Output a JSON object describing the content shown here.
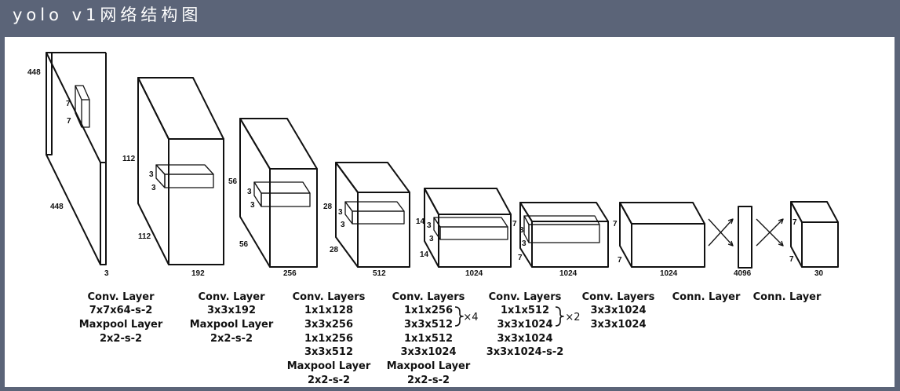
{
  "header": {
    "title": "yolo v1网络结构图"
  },
  "diagram": {
    "dims": {
      "in_448_top": "448",
      "in_448_side": "448",
      "in_3": "3",
      "in_k7a": "7",
      "in_k7b": "7",
      "b1_112a": "112",
      "b1_112b": "112",
      "b1_192": "192",
      "b1_k3a": "3",
      "b1_k3b": "3",
      "b2_56a": "56",
      "b2_56b": "56",
      "b2_256": "256",
      "b2_k3a": "3",
      "b2_k3b": "3",
      "b3_28a": "28",
      "b3_28b": "28",
      "b3_512": "512",
      "b3_k3a": "3",
      "b3_k3b": "3",
      "b4_14a": "14",
      "b4_14b": "14",
      "b4_1024": "1024",
      "b4_k3a": "3",
      "b4_k3b": "3",
      "b5_7a": "7",
      "b5_7b": "7",
      "b5_1024": "1024",
      "b5_k3a": "3",
      "b5_k3b": "3",
      "b6_7a": "7",
      "b6_7b": "7",
      "b6_1024": "1024",
      "fc_4096": "4096",
      "out_7a": "7",
      "out_7b": "7",
      "out_30": "30"
    },
    "captions": {
      "c1": [
        "Conv. Layer",
        "7x7x64-s-2",
        "Maxpool Layer",
        "2x2-s-2"
      ],
      "c2": [
        "Conv. Layer",
        "3x3x192",
        "Maxpool Layer",
        "2x2-s-2"
      ],
      "c3": [
        "Conv. Layers",
        "1x1x128",
        "3x3x256",
        "1x1x256",
        "3x3x512",
        "Maxpool Layer",
        "2x2-s-2"
      ],
      "c4": [
        "Conv. Layers",
        "1x1x256",
        "3x3x512",
        "1x1x512",
        "3x3x1024",
        "Maxpool Layer",
        "2x2-s-2"
      ],
      "c4_repeat": "×4",
      "c5": [
        "Conv. Layers",
        "1x1x512",
        "3x3x1024",
        "3x3x1024",
        "3x3x1024-s-2"
      ],
      "c5_repeat": "×2",
      "c6": [
        "Conv. Layers",
        "3x3x1024",
        "3x3x1024"
      ],
      "c7": [
        "Conn. Layer"
      ],
      "c8": [
        "Conn. Layer"
      ]
    }
  }
}
